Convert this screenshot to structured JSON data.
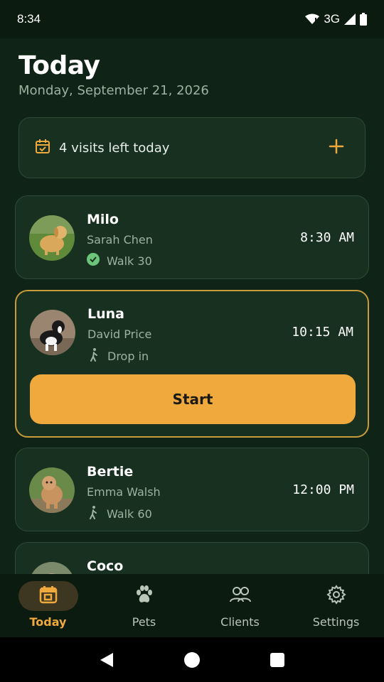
{
  "status_bar": {
    "time": "8:34",
    "network": "3G"
  },
  "header": {
    "title": "Today",
    "date": "Monday, September 21, 2026"
  },
  "summary": {
    "text": "4 visits left today",
    "icon": "calendar-check-icon",
    "add_icon": "plus-icon"
  },
  "visits": [
    {
      "pet": "Milo",
      "owner": "Sarah Chen",
      "type": "Walk 30",
      "type_icon": "check-circle-icon",
      "time": "8:30 AM",
      "completed": true
    },
    {
      "pet": "Luna",
      "owner": "David Price",
      "type": "Drop in",
      "type_icon": "walking-person-icon",
      "time": "10:15 AM",
      "active": true,
      "start_label": "Start"
    },
    {
      "pet": "Bertie",
      "owner": "Emma Walsh",
      "type": "Walk 60",
      "type_icon": "walking-person-icon",
      "time": "12:00 PM"
    },
    {
      "pet": "Coco"
    }
  ],
  "nav": [
    {
      "label": "Today",
      "icon": "calendar-icon",
      "active": true
    },
    {
      "label": "Pets",
      "icon": "paw-icon"
    },
    {
      "label": "Clients",
      "icon": "people-icon"
    },
    {
      "label": "Settings",
      "icon": "gear-icon"
    }
  ],
  "colors": {
    "accent": "#f0a93c",
    "background": "#0f2416",
    "card": "#173020",
    "success": "#6cc47a"
  }
}
